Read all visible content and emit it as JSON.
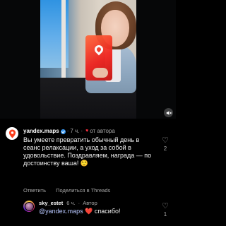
{
  "video": {
    "mute_icon": "speaker-muted-icon"
  },
  "comment": {
    "username": "yandex.maps",
    "time": "7 ч.",
    "author_badge": "от автора",
    "text": "Вы умеете превратить обычный день в сеанс релаксации, а уход за собой в удовольствие. Поздравляем, награда — по достоинству ваша! 😌",
    "reply_label": "Ответить",
    "share_label": "Поделиться в Threads",
    "like_count": "2"
  },
  "reply": {
    "username": "sky_estet",
    "time": "6 ч.",
    "author_label": "Автор",
    "mention": "@yandex.maps",
    "heart": "❤️",
    "text": "спасибо!",
    "like_count": "1"
  },
  "colors": {
    "background": "#000000",
    "muted_text": "#a8a8a8",
    "like_red": "#ff3040",
    "mention": "#b8c7ff",
    "verified": "#3897f0"
  }
}
